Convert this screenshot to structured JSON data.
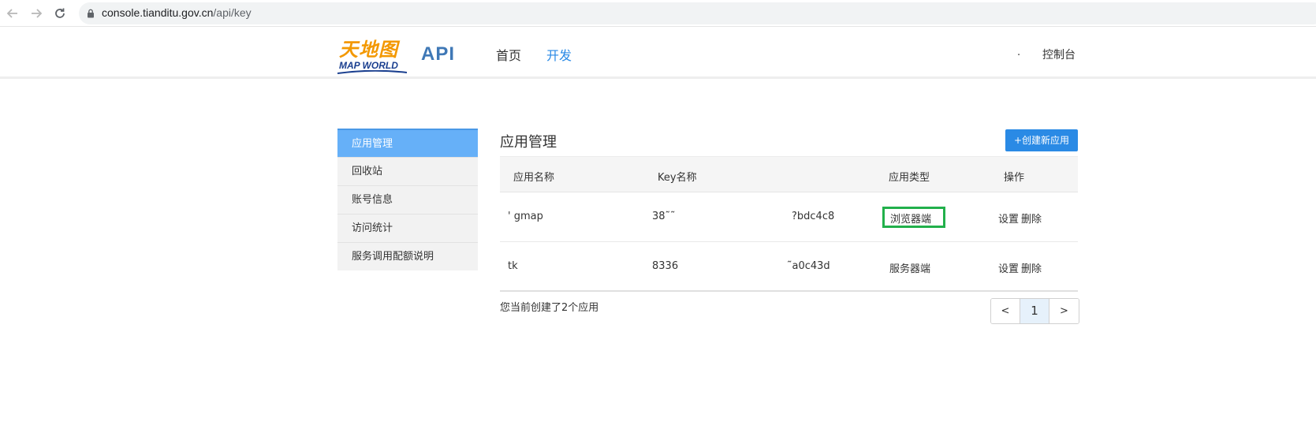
{
  "browser": {
    "url_host": "console.tianditu.gov.cn",
    "url_path": "/api/key"
  },
  "header": {
    "logo_cn": "天地图",
    "logo_en": "MAP WORLD",
    "api_label": "API",
    "nav": [
      {
        "label": "首页",
        "active": false
      },
      {
        "label": "开发",
        "active": true
      }
    ],
    "user": ".",
    "console_label": "控制台"
  },
  "sidebar": {
    "items": [
      {
        "label": "应用管理",
        "active": true
      },
      {
        "label": "回收站",
        "active": false
      },
      {
        "label": "账号信息",
        "active": false
      },
      {
        "label": "访问统计",
        "active": false
      },
      {
        "label": "服务调用配额说明",
        "active": false
      }
    ]
  },
  "main": {
    "title": "应用管理",
    "create_button": "+创建新应用",
    "table": {
      "headers": {
        "app_name": "应用名称",
        "key_name": "Key名称",
        "app_type": "应用类型",
        "actions": "操作"
      },
      "rows": [
        {
          "name": "' gmap",
          "key_start": "38˜˜",
          "key_end": "?bdc4c8",
          "type": "浏览器端",
          "set": "设置",
          "delete": "删除"
        },
        {
          "name": "tk",
          "key_start": "8336",
          "key_end": "˜a0c43d",
          "type": "服务器端",
          "set": "设置",
          "delete": "删除"
        }
      ]
    },
    "count_text": "您当前创建了2个应用",
    "pagination": {
      "prev": "<",
      "current": "1",
      "next": ">"
    }
  },
  "colors": {
    "accent": "#2a8ae5",
    "sidebar_active": "#66b0f8",
    "highlight_box": "#22b04b",
    "logo_orange": "#f39800",
    "logo_blue": "#1a3f8f"
  }
}
